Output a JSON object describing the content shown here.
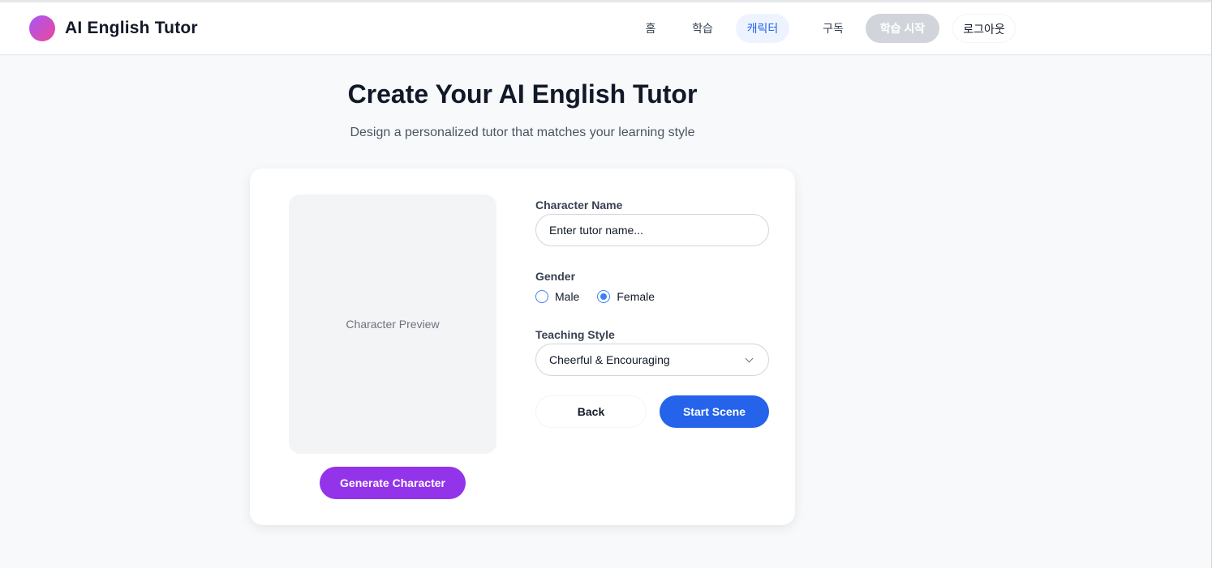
{
  "header": {
    "brand": "AI English Tutor",
    "nav": {
      "home": "홈",
      "learn": "학습",
      "character": "캐릭터",
      "subscribe": "구독",
      "start_learning": "학습 시작",
      "logout": "로그아웃"
    },
    "active_nav": "캐릭터"
  },
  "main": {
    "title": "Create Your AI English Tutor",
    "subtitle": "Design a personalized tutor that matches your learning style"
  },
  "card": {
    "preview_text": "Character Preview",
    "generate_label": "Generate Character",
    "name": {
      "label": "Character Name",
      "placeholder": "Enter tutor name...",
      "value": ""
    },
    "gender": {
      "label": "Gender",
      "options": [
        "Male",
        "Female"
      ],
      "selected": "Female"
    },
    "teaching_style": {
      "label": "Teaching Style",
      "selected": "Cheerful & Encouraging"
    },
    "back_label": "Back",
    "start_label": "Start Scene"
  },
  "colors": {
    "primary": "#2563eb",
    "accent_purple": "#9333ea",
    "active_nav_bg": "#eef4ff",
    "disabled_gray": "#d1d5db"
  },
  "icons": {
    "logo": "gradient-circle-logo",
    "select": "chevron-down-icon"
  }
}
